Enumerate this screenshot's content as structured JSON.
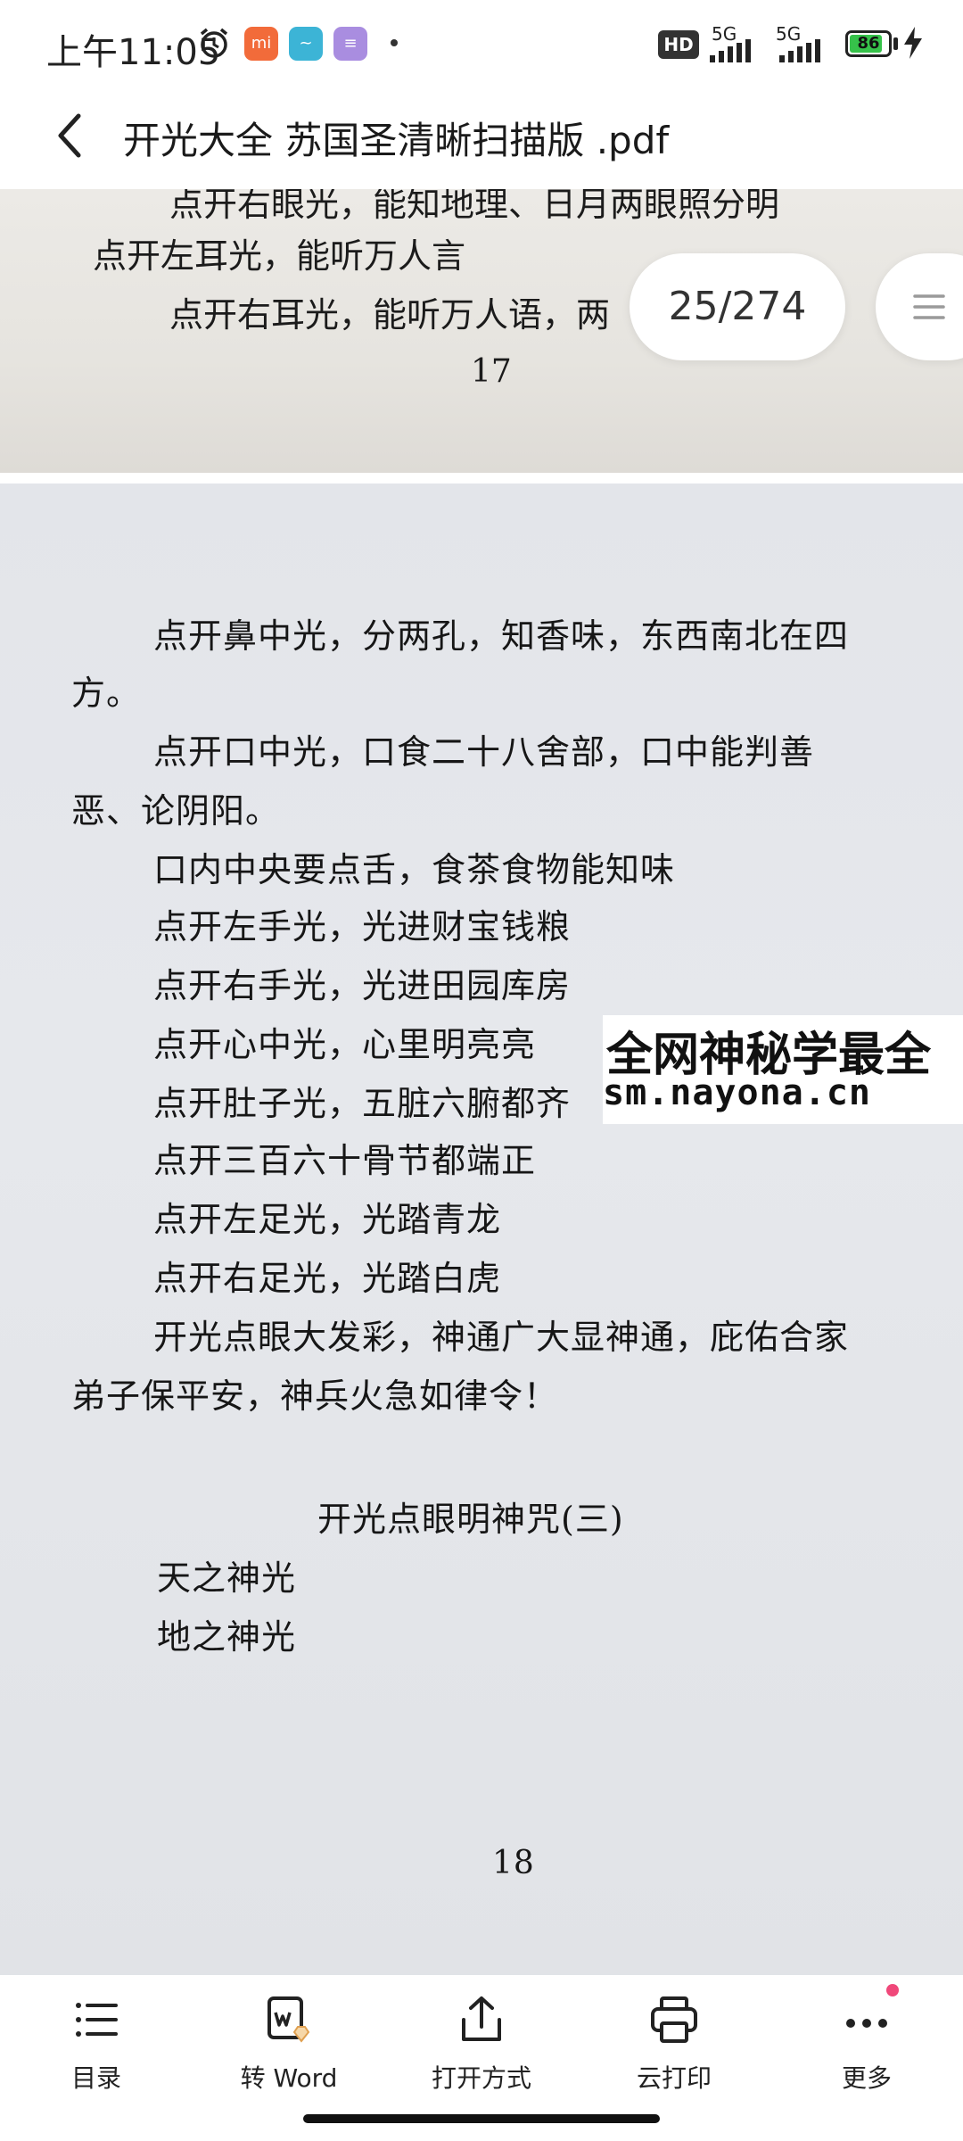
{
  "status_bar": {
    "time": "上午11:05",
    "signal_labels": [
      "5G",
      "5G"
    ],
    "hd_label": "HD",
    "battery_level": "86",
    "battery_fill_fraction": 0.86,
    "icons": [
      "alarm-icon",
      "mi-app-icon",
      "teal-app-icon",
      "purple-app-icon",
      "bolt-icon"
    ]
  },
  "header": {
    "back_icon": "chevron-left-icon",
    "title": "开光大全  苏国圣清晰扫描版 .pdf"
  },
  "page_indicator": {
    "text": "25/274"
  },
  "page_17": {
    "lines": [
      "点开右眼光，能知地理、日月两眼照分明",
      "点开左耳光，能听万人言",
      "点开右耳光，能听万人语，两"
    ],
    "page_number": "17"
  },
  "page_18": {
    "lines": [
      "点开鼻中光，分两孔，知香味，东西南北在四",
      "方。",
      "点开口中光，口食二十八舍部，口中能判善",
      "恶、论阴阳。",
      "口内中央要点舌，食茶食物能知味",
      "点开左手光，光进财宝钱粮",
      "点开右手光，光进田园库房",
      "点开心中光，心里明亮亮",
      "点开肚子光，五脏六腑都齐",
      "点开三百六十骨节都端正",
      "点开左足光，光踏青龙",
      "点开右足光，光踏白虎",
      "开光点眼大发彩，神通广大显神通，庇佑合家",
      "弟子保平安，神兵火急如律令！",
      "开光点眼明神咒(三)",
      "天之神光",
      "地之神光"
    ],
    "page_number": "18"
  },
  "watermark": {
    "line1": "全网神秘学最全",
    "line2": "sm.nayona.cn"
  },
  "toolbar": {
    "items": [
      {
        "label": "目录",
        "icon": "list-icon"
      },
      {
        "label": "转 Word",
        "icon": "word-convert-icon"
      },
      {
        "label": "打开方式",
        "icon": "share-icon"
      },
      {
        "label": "云打印",
        "icon": "printer-icon"
      },
      {
        "label": "更多",
        "icon": "more-icon"
      }
    ]
  },
  "colors": {
    "notification_dot": "#f0487a",
    "battery": "#36c24a"
  }
}
